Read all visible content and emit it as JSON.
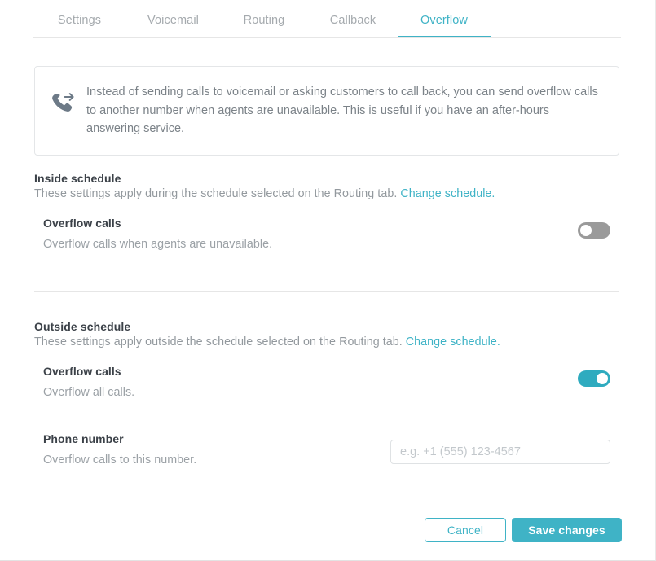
{
  "tabs": [
    {
      "id": "settings",
      "label": "Settings",
      "active": false
    },
    {
      "id": "voicemail",
      "label": "Voicemail",
      "active": false
    },
    {
      "id": "routing",
      "label": "Routing",
      "active": false
    },
    {
      "id": "callback",
      "label": "Callback",
      "active": false
    },
    {
      "id": "overflow",
      "label": "Overflow",
      "active": true
    }
  ],
  "banner": {
    "icon": "call-forward-icon",
    "text": "Instead of sending calls to voicemail or asking customers to call back, you can send overflow calls to another number when agents are unavailable. This is useful if you have an after-hours answering service."
  },
  "inside_schedule": {
    "title": "Inside schedule",
    "description": "These settings apply during the schedule selected on the Routing tab.",
    "link_label": "Change schedule.",
    "overflow_calls": {
      "title": "Overflow calls",
      "description": "Overflow calls when agents are unavailable.",
      "toggle_state": "off"
    }
  },
  "outside_schedule": {
    "title": "Outside schedule",
    "description": "These settings apply outside the schedule selected on the Routing tab.",
    "link_label": "Change schedule.",
    "overflow_calls": {
      "title": "Overflow calls",
      "description": "Overflow all calls.",
      "toggle_state": "on"
    },
    "phone_number": {
      "title": "Phone number",
      "description": "Overflow calls to this number.",
      "placeholder": "e.g. +1 (555) 123-4567",
      "value": ""
    }
  },
  "footer": {
    "cancel_label": "Cancel",
    "save_label": "Save changes"
  },
  "colors": {
    "accent": "#3fb3c6",
    "toggle_on": "#2fabbf",
    "toggle_off": "#9a9a9a",
    "heading": "#3b4148",
    "muted": "#93999e"
  }
}
